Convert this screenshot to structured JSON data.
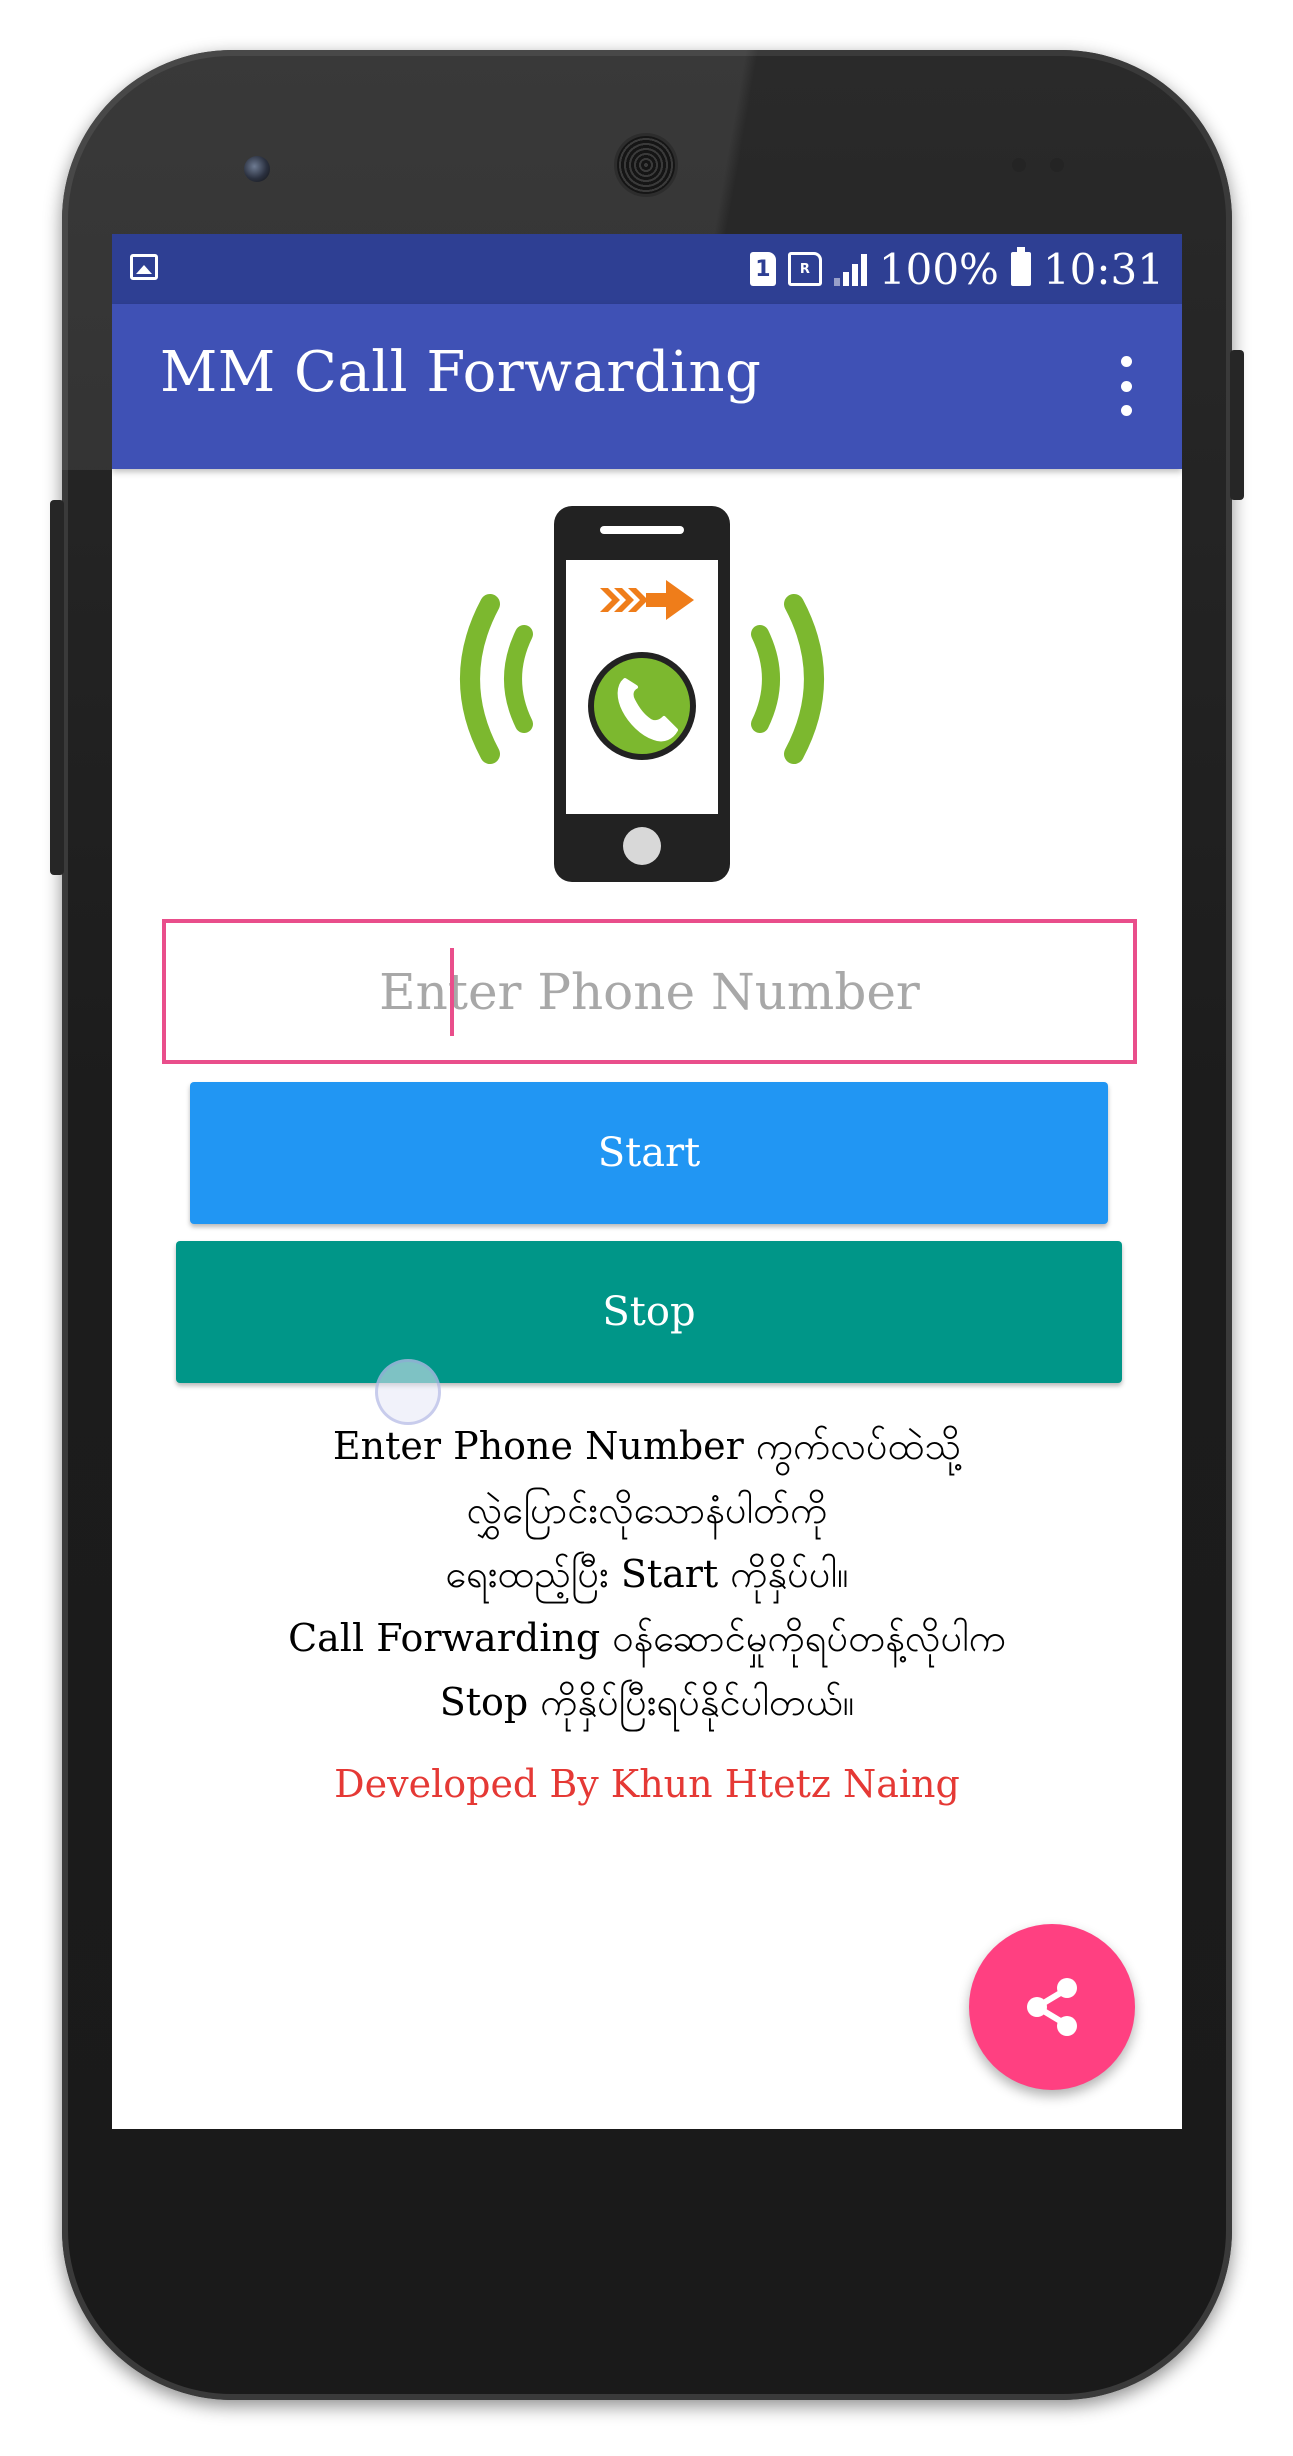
{
  "status_bar": {
    "sim1_label": "1",
    "sim2_label": "R",
    "battery": "100%",
    "time": "10:31"
  },
  "app_bar": {
    "title": "MM Call Forwarding"
  },
  "form": {
    "phone_placeholder": "Enter Phone Number",
    "phone_value": "",
    "start_label": "Start",
    "stop_label": "Stop"
  },
  "instructions": {
    "line1": "Enter Phone Number ကွက်လပ်ထဲသို့",
    "line2": "လွှဲပြောင်းလိုသောနံပါတ်ကို",
    "line3": "ရေးထည့်ပြီး Start ကိုနှိပ်ပါ။",
    "line4": "Call Forwarding ဝန်ဆောင်မှုကိုရပ်တန့်လိုပါက",
    "line5": "Stop ကိုနှိပ်ပြီးရပ်နိုင်ပါတယ်။"
  },
  "credit": "Developed By Khun Htetz Naing",
  "colors": {
    "status_bar": "#2e3f93",
    "app_bar": "#3f51b5",
    "start_button": "#2196f3",
    "stop_button": "#009688",
    "input_border": "#e94e8b",
    "credit_text": "#e53935",
    "fab": "#ff4081",
    "wave_green": "#7cb82f",
    "arrow_orange": "#ef7d1a"
  },
  "icons": {
    "status_left": "image-icon",
    "fab": "share-icon",
    "overflow": "more-vert-icon",
    "hero": "call-forward-phone-icon"
  }
}
